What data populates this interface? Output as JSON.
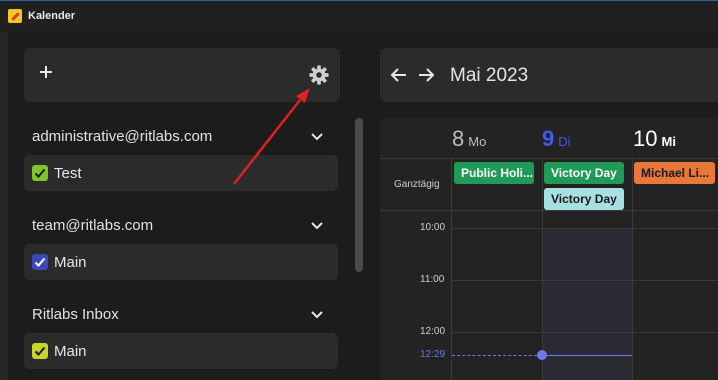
{
  "window": {
    "title": "Kalender"
  },
  "sidebar": {
    "toolbar": {
      "add_icon": "plus-icon",
      "settings_icon": "gear-icon"
    },
    "accounts": [
      {
        "name": "administrative@ritlabs.com",
        "calendars": [
          {
            "name": "Test",
            "color": "#7ec42a",
            "checked": true
          }
        ]
      },
      {
        "name": "team@ritlabs.com",
        "calendars": [
          {
            "name": "Main",
            "color": "#3b49b8",
            "checked": true
          }
        ]
      },
      {
        "name": "Ritlabs Inbox",
        "calendars": [
          {
            "name": "Main",
            "color": "#c8d62a",
            "checked": true
          }
        ]
      }
    ],
    "annotation_arrow_color": "#e02020"
  },
  "calendar": {
    "month_label": "Mai 2023",
    "days": [
      {
        "num": "8",
        "weekday": "Mo",
        "today": false
      },
      {
        "num": "9",
        "weekday": "Di",
        "today": true
      },
      {
        "num": "10",
        "weekday": "Mi",
        "today": false
      }
    ],
    "all_day_label": "Ganztägig",
    "events": [
      {
        "label": "Public Holi...",
        "color": "#1f9a57",
        "text_color": "#ffffff"
      },
      {
        "label": "Victory Day",
        "color": "#1f9a57",
        "text_color": "#ffffff"
      },
      {
        "label": "Victory Day",
        "color": "#a8dfe0",
        "text_color": "#1a1a1a"
      },
      {
        "label": "Michael Li...",
        "color": "#e8773a",
        "text_color": "#1a1a1a"
      }
    ],
    "times": [
      "10:00",
      "11:00",
      "12:00"
    ],
    "current_time": "12:29",
    "today_color": "#3f5bf0",
    "now_color": "#6f78e6"
  }
}
